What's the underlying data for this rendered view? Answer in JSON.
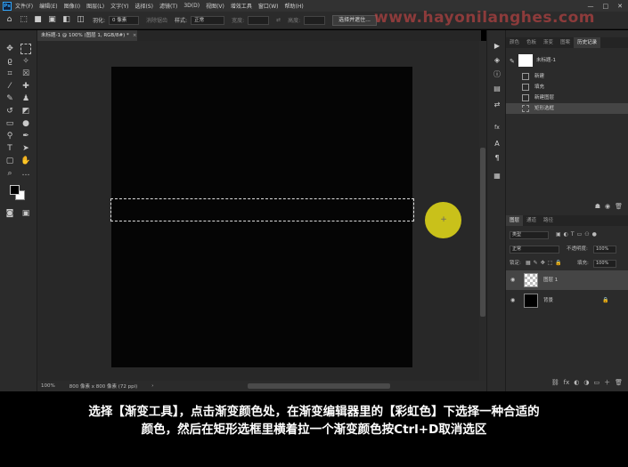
{
  "app": {
    "logo": "Ps"
  },
  "menu": [
    "文件(F)",
    "编辑(E)",
    "图像(I)",
    "图层(L)",
    "文字(Y)",
    "选择(S)",
    "滤镜(T)",
    "3D(D)",
    "视图(V)",
    "增效工具",
    "窗口(W)",
    "帮助(H)"
  ],
  "window_controls": [
    "—",
    "□",
    "✕"
  ],
  "options": {
    "feather_label": "羽化:",
    "feather_value": "0 像素",
    "antialias_label": "消除锯齿",
    "style_label": "样式:",
    "style_value": "正常",
    "width_label": "宽度:",
    "height_label": "高度:",
    "select_mask_btn": "选择并遮住..."
  },
  "watermark": "www.hayonilanghes.com",
  "document": {
    "tab_title": "未标题-1 @ 100% (图层 1, RGB/8#) *",
    "close": "×",
    "zoom": "100%",
    "size_info": "800 像素 x 800 像素 (72 ppi)"
  },
  "history_panel": {
    "tabs": [
      "颜色",
      "色板",
      "渐变",
      "图案",
      "历史记录"
    ],
    "active_tab": 4,
    "snapshot": "未标题-1",
    "items": [
      "新建",
      "填充",
      "新建图层",
      "矩形选框"
    ],
    "selected_index": 3
  },
  "layers_panel": {
    "tabs": [
      "图层",
      "通道",
      "路径"
    ],
    "active_tab": 0,
    "kind_filter": "类型",
    "blend_mode": "正常",
    "opacity_label": "不透明度:",
    "opacity_value": "100%",
    "lock_label": "锁定:",
    "fill_label": "填充:",
    "fill_value": "100%",
    "layers": [
      {
        "name": "图层 1",
        "selected": true,
        "thumb": "transparent"
      },
      {
        "name": "背景",
        "selected": false,
        "thumb": "black",
        "lock": "🔒"
      }
    ],
    "footer_icons": [
      "⛓",
      "fx",
      "◐",
      "◑",
      "▭",
      "＋",
      "🗑"
    ]
  },
  "subtitle": {
    "line1": "选择【渐变工具】，点击渐变颜色处，在渐变编辑器里的【彩虹色】下选择一种合适的",
    "line2": "颜色，然后在矩形选框里横着拉一个渐变颜色按Ctrl+D取消选区"
  },
  "colors": {
    "accent": "#31a8ff",
    "cursor": "#c9c11a",
    "foreground": "#000000",
    "background": "#ffffff"
  }
}
